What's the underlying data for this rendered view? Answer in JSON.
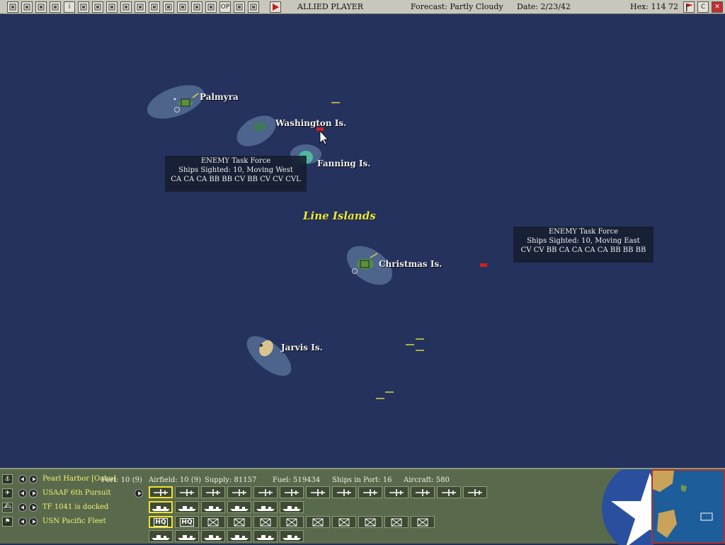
{
  "topbar": {
    "player": "ALLIED PLAYER",
    "forecast": "Forecast: Partly Cloudy",
    "date": "Date: 2/23/42",
    "hex": "Hex: 114  72",
    "buttons": [
      {
        "name": "map-view-icon"
      },
      {
        "name": "report-icon"
      },
      {
        "name": "intel-icon"
      },
      {
        "name": "routes-icon"
      },
      {
        "name": "info-icon",
        "glyph": "i"
      },
      {
        "name": "bases-star-icon"
      },
      {
        "name": "air-ops-icon"
      },
      {
        "name": "air-units-icon"
      },
      {
        "name": "flag-icon"
      },
      {
        "name": "ship-icon"
      },
      {
        "name": "routes-toggle-icon"
      },
      {
        "name": "allied-axis-icon"
      },
      {
        "name": "fleet-icon"
      },
      {
        "name": "globe-icon"
      },
      {
        "name": "reinforcements-icon"
      },
      {
        "name": "op-icon",
        "glyph": "OP"
      },
      {
        "name": "list-icon"
      },
      {
        "name": "history-icon"
      }
    ],
    "end_turn_icon": "play-icon",
    "right_buttons": [
      {
        "name": "options-flag-icon"
      },
      {
        "name": "c-icon",
        "glyph": "C"
      },
      {
        "name": "exit-icon",
        "glyph": "✕"
      }
    ]
  },
  "map": {
    "region_label": "Line Islands",
    "islands": [
      {
        "label": "Palmyra"
      },
      {
        "label": "Washington Is."
      },
      {
        "label": "Fanning Is."
      },
      {
        "label": "Christmas Is."
      },
      {
        "label": "Jarvis Is."
      }
    ],
    "task_forces": [
      {
        "line1": "ENEMY Task Force",
        "line2": "Ships Sighted: 10, Moving West",
        "line3": "CA CA CA BB BB CV BB CV CV CVL"
      },
      {
        "line1": "ENEMY Task Force",
        "line2": "Ships Sighted: 10, Moving East",
        "line3": "CV CV BB CA CA CA CA BB BB BB"
      }
    ],
    "colors": {
      "ocean": "#25325d",
      "enemy": "#d02020",
      "friendly": "#d8d840"
    }
  },
  "bottom": {
    "rows": [
      {
        "label": "Pearl Harbor [Oahu]",
        "icon": "anchor-icon"
      },
      {
        "label": "USAAF 6th Pursuit",
        "icon": "plane-icon"
      },
      {
        "label": "TF 1041 is docked",
        "icon": "ship-icon"
      },
      {
        "label": "USN Pacific Fleet",
        "icon": "flag-icon"
      }
    ],
    "stats": {
      "port": "Port: 10 (9)",
      "airfield": "Airfield: 10 (9)",
      "supply": "Supply: 81157",
      "fuel": "Fuel: 519434",
      "ships": "Ships in Port: 16",
      "aircraft": "Aircraft: 580"
    },
    "hq_label": "HQ",
    "minimap_label": "strategic-minimap"
  }
}
